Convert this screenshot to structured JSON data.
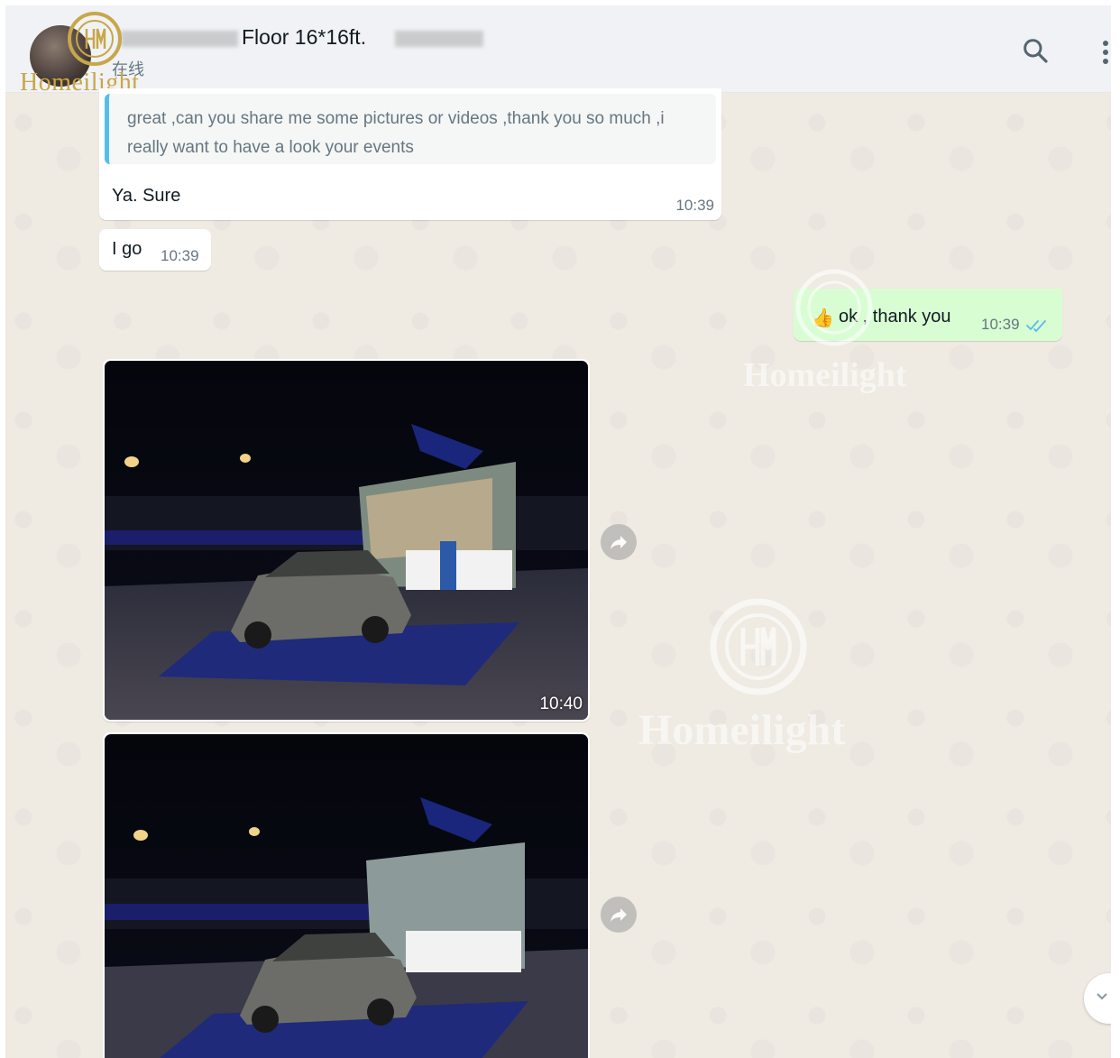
{
  "header": {
    "contact_name": "Floor 16*16ft.",
    "status": "在线",
    "logo_text": "Homeilight"
  },
  "watermark_text": "Homeilight",
  "messages": {
    "quoted_text": "great ,can you share me some pictures or videos ,thank you so much ,i really want to have a look your events",
    "reply_text": "Ya. Sure",
    "reply_time": "10:39",
    "msg2_text": "I go",
    "msg2_time": "10:39",
    "out_emoji": "👍",
    "out_text": "ok , thank you",
    "out_time": "10:39",
    "image1_time": "10:40"
  },
  "colors": {
    "chat_bg": "#efeae2",
    "outgoing_bubble": "#d9fdd3",
    "quote_bar": "#53bdeb",
    "read_ticks": "#53bdeb"
  },
  "icons": [
    "search-icon",
    "menu-icon",
    "forward-icon",
    "double-check-icon",
    "chevron-down-icon"
  ]
}
